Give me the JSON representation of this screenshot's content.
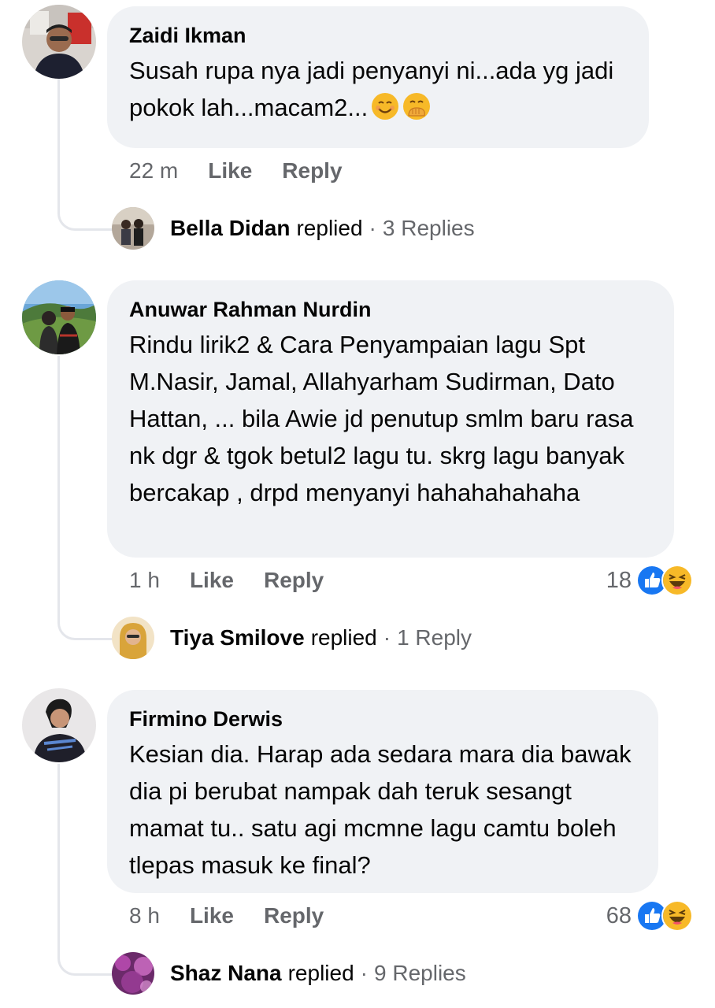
{
  "comments": [
    {
      "author": "Zaidi Ikman",
      "text": "Susah rupa nya jadi penyanyi ni...ada yg jadi pokok lah...macam2...",
      "emojis": [
        "smiling-face-icon",
        "face-with-hand-over-mouth-icon"
      ],
      "time": "22 m",
      "like_label": "Like",
      "reply_label": "Reply",
      "reaction_count": "",
      "reply_summary": {
        "name": "Bella Didan",
        "verb": "replied",
        "dot": "·",
        "count": "3 Replies"
      }
    },
    {
      "author": "Anuwar Rahman Nurdin",
      "text": "Rindu lirik2 & Cara Penyampaian lagu Spt M.Nasir, Jamal, Allahyarham Sudirman, Dato Hattan, ... bila Awie jd penutup smlm baru rasa nk dgr & tgok betul2 lagu tu. skrg lagu banyak bercakap , drpd menyanyi hahahahahaha",
      "time": "1 h",
      "like_label": "Like",
      "reply_label": "Reply",
      "reaction_count": "18",
      "reactions": [
        "like-reaction-icon",
        "haha-reaction-icon"
      ],
      "reply_summary": {
        "name": "Tiya Smilove",
        "verb": "replied",
        "dot": "·",
        "count": "1 Reply"
      }
    },
    {
      "author": "Firmino Derwis",
      "text": "Kesian dia. Harap ada sedara mara dia bawak dia pi berubat nampak dah teruk sesangt mamat tu.. satu agi mcmne lagu camtu boleh tlepas masuk ke final?",
      "time": "8 h",
      "like_label": "Like",
      "reply_label": "Reply",
      "reaction_count": "68",
      "reactions": [
        "like-reaction-icon",
        "haha-reaction-icon"
      ],
      "reply_summary": {
        "name": "Shaz Nana",
        "verb": "replied",
        "dot": "·",
        "count": "9 Replies"
      }
    }
  ],
  "colors": {
    "bubble_bg": "#f0f2f5",
    "secondary_text": "#65676b",
    "primary_text": "#050505",
    "like_blue": "#1877f2",
    "haha_yellow": "#f7b928",
    "thread_line": "#e4e6eb"
  }
}
